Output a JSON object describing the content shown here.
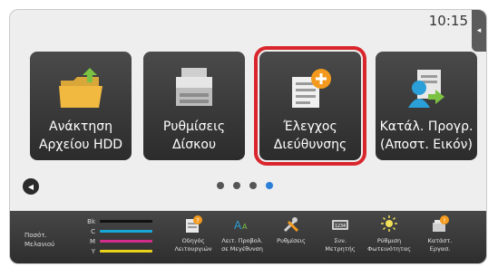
{
  "clock": "10:15",
  "tiles": [
    {
      "label1": "Ανάκτηση",
      "label2": "Αρχείου HDD",
      "icon": "folder-icon"
    },
    {
      "label1": "Ρυθμίσεις",
      "label2": "Δίσκου",
      "icon": "printer-icon"
    },
    {
      "label1": "Έλεγχος",
      "label2": "Διεύθυνσης",
      "icon": "address-book-add-icon"
    },
    {
      "label1": "Κατάλ. Προγρ.",
      "label2": "(Αποστ. Εικόν)",
      "icon": "send-list-icon"
    }
  ],
  "pager": {
    "count": 4,
    "active_index": 3
  },
  "toner": {
    "label1": "Ποσότ.",
    "label2": "Μελανιού",
    "rows": [
      {
        "code": "Bk",
        "color": "#111111",
        "level": 1.0
      },
      {
        "code": "C",
        "color": "#19a7d6",
        "level": 1.0
      },
      {
        "code": "M",
        "color": "#d12d8c",
        "level": 1.0
      },
      {
        "code": "Y",
        "color": "#e8d21a",
        "level": 1.0
      }
    ]
  },
  "functions": [
    {
      "line1": "Οδηγός",
      "line2": "Λειτουργιών",
      "icon": "guide-icon"
    },
    {
      "line1": "Λειτ. Προβολ.",
      "line2": "σε Μεγέθυνση",
      "icon": "zoom-text-icon"
    },
    {
      "line1": "Ρυθμίσεις",
      "line2": "",
      "icon": "tools-icon"
    },
    {
      "line1": "Συν.",
      "line2": "Μετρητής",
      "icon": "counter-icon"
    },
    {
      "line1": "Ρύθμιση",
      "line2": "Φωτεινότητας",
      "icon": "brightness-icon"
    },
    {
      "line1": "Κατάστ.",
      "line2": "Εργασ.",
      "icon": "job-status-icon"
    }
  ],
  "colors": {
    "accent": "#d9262c",
    "active_dot": "#2a7fd8"
  }
}
